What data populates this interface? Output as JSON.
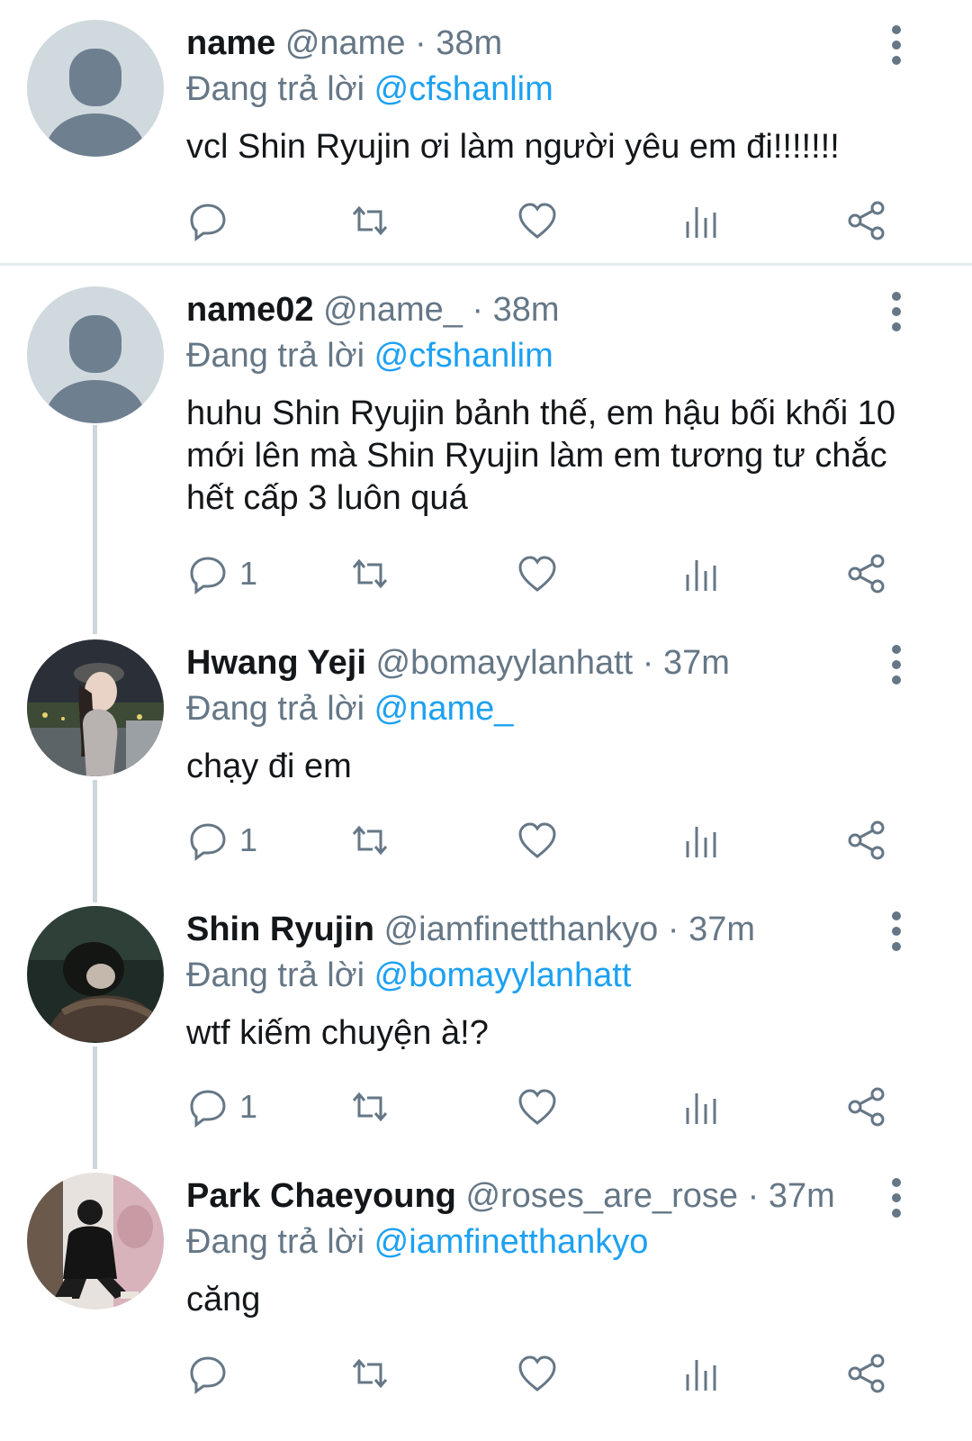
{
  "tweets": [
    {
      "name": "name",
      "handle": "@name",
      "time": " · 38m",
      "reply_prefix": "Đang trả lời ",
      "reply_to": "@cfshanlim",
      "text": "vcl Shin Ryujin ơi làm người yêu em đi!!!!!!!",
      "reply_count": ""
    },
    {
      "name": "name02",
      "handle": "@name_",
      "time": " · 38m",
      "reply_prefix": "Đang trả lời ",
      "reply_to": "@cfshanlim",
      "text": "huhu Shin Ryujin bảnh thế, em hậu bối khối 10 mới lên mà Shin Ryujin làm em tương tư chắc hết cấp 3 luôn quá",
      "reply_count": "1"
    },
    {
      "name": "Hwang Yeji",
      "handle": "@bomayylanhatt",
      "time": " · 37m",
      "reply_prefix": "Đang trả lời ",
      "reply_to": "@name_",
      "text": "chạy đi em",
      "reply_count": "1"
    },
    {
      "name": "Shin Ryujin",
      "handle": "@iamfinetthankyo",
      "time": " · 37m",
      "reply_prefix": "Đang trả lời ",
      "reply_to": "@bomayylanhatt",
      "text": "wtf kiếm chuyện à!?",
      "reply_count": "1"
    },
    {
      "name": "Park Chaeyoung",
      "handle": "@roses_are_rose",
      "time": " · 37m",
      "reply_prefix": "Đang trả lời ",
      "reply_to": "@iamfinetthankyo",
      "text": "căng",
      "reply_count": ""
    }
  ],
  "icons": {
    "reply": "reply-icon",
    "retweet": "retweet-icon",
    "like": "heart-icon",
    "analytics": "analytics-icon",
    "share": "share-icon",
    "more": "more-vertical-icon"
  },
  "colors": {
    "mention": "#1da1f2",
    "secondary_text": "#657786",
    "thread_line": "#ccd6dd",
    "default_avatar_bg": "#cfd9de"
  }
}
